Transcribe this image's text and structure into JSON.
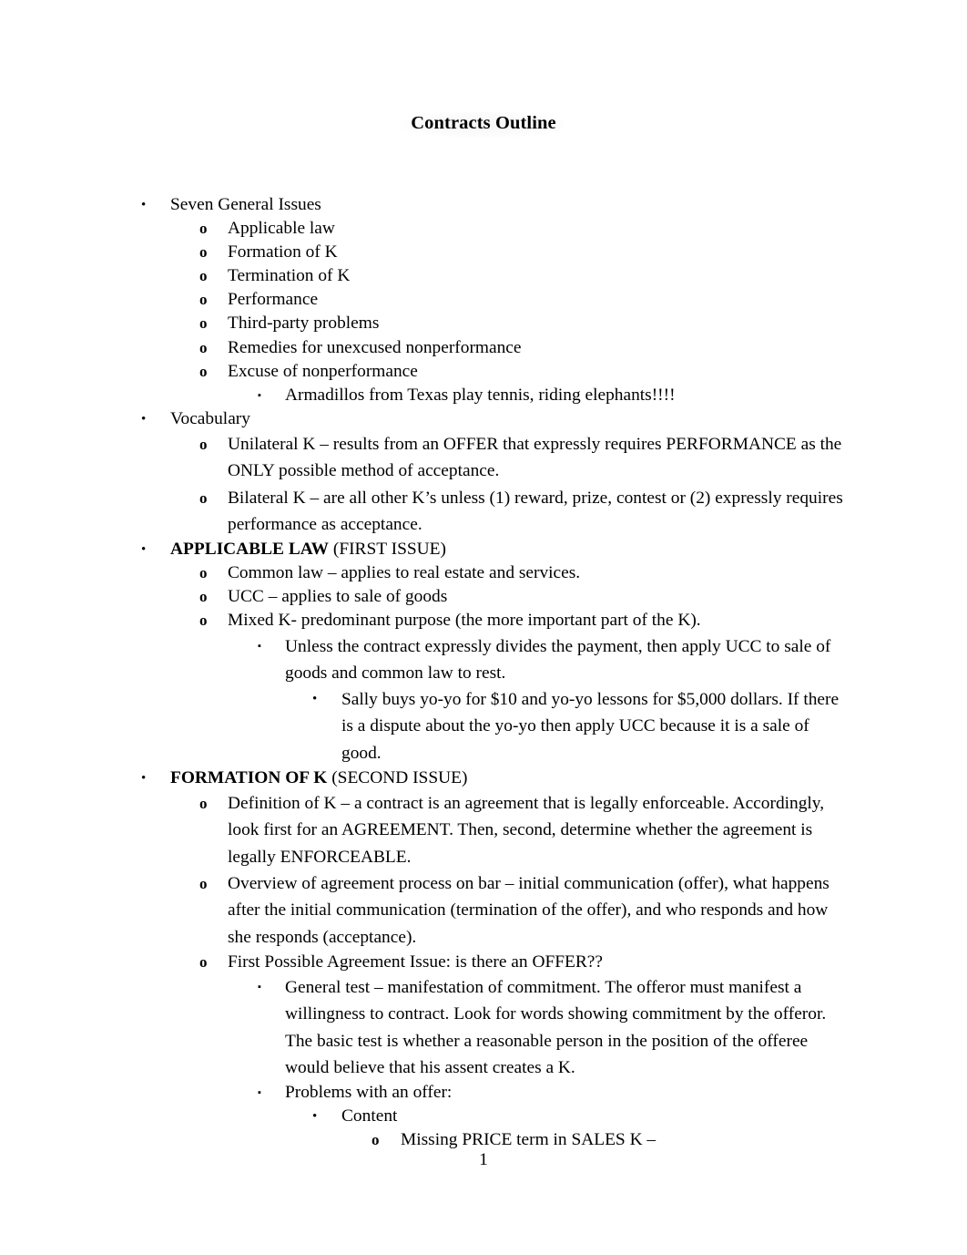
{
  "document": {
    "title": "Contracts Outline",
    "page_number": "1"
  },
  "markers": {
    "bullet_round": "•",
    "bullet_circle_o": "o",
    "bullet_square": "▪"
  },
  "outline": [
    {
      "level": 1,
      "marker": "•",
      "text": "Seven General Issues",
      "multiline": false
    },
    {
      "level": 2,
      "marker": "o",
      "text": "Applicable law",
      "multiline": false
    },
    {
      "level": 2,
      "marker": "o",
      "text": "Formation of K",
      "multiline": false
    },
    {
      "level": 2,
      "marker": "o",
      "text": "Termination of K",
      "multiline": false
    },
    {
      "level": 2,
      "marker": "o",
      "text": "Performance",
      "multiline": false
    },
    {
      "level": 2,
      "marker": "o",
      "text": "Third-party problems",
      "multiline": false
    },
    {
      "level": 2,
      "marker": "o",
      "text": "Remedies for unexcused nonperformance",
      "multiline": false
    },
    {
      "level": 2,
      "marker": "o",
      "text": "Excuse of nonperformance",
      "multiline": false
    },
    {
      "level": 3,
      "marker": "▪",
      "text": "Armadillos from Texas play tennis, riding elephants!!!!",
      "multiline": false
    },
    {
      "level": 1,
      "marker": "•",
      "text": "Vocabulary",
      "multiline": false
    },
    {
      "level": 2,
      "marker": "o",
      "text": "Unilateral K – results from an OFFER that expressly requires PERFORMANCE as the ONLY possible method of acceptance.",
      "multiline": true
    },
    {
      "level": 2,
      "marker": "o",
      "text": "Bilateral K – are all other K’s unless (1) reward, prize, contest or (2) expressly requires performance as acceptance.",
      "multiline": true
    },
    {
      "level": 1,
      "marker": "•",
      "bold_prefix": "APPLICABLE LAW",
      "text": " (FIRST ISSUE)",
      "multiline": false
    },
    {
      "level": 2,
      "marker": "o",
      "text": "Common law – applies to real estate and services.",
      "multiline": false
    },
    {
      "level": 2,
      "marker": "o",
      "text": "UCC – applies to sale of goods",
      "multiline": false
    },
    {
      "level": 2,
      "marker": "o",
      "text": "Mixed K- predominant purpose (the more important part of the K).",
      "multiline": false
    },
    {
      "level": 3,
      "marker": "▪",
      "text": "Unless the contract expressly divides the payment, then apply UCC to sale of goods and common law to rest.",
      "multiline": true
    },
    {
      "level": 4,
      "marker": "•",
      "text": "Sally buys yo-yo for $10 and yo-yo lessons for $5,000 dollars. If there is a dispute about the yo-yo then apply UCC because it is a sale of good.",
      "multiline": true
    },
    {
      "level": 1,
      "marker": "•",
      "bold_prefix": "FORMATION OF K",
      "text": " (SECOND ISSUE)",
      "multiline": false
    },
    {
      "level": 2,
      "marker": "o",
      "text": "Definition of K – a contract is an agreement that is legally enforceable. Accordingly, look first for an AGREEMENT. Then, second, determine whether the agreement is legally ENFORCEABLE.",
      "multiline": true
    },
    {
      "level": 2,
      "marker": "o",
      "text": "Overview of agreement process on bar – initial communication (offer), what happens after the initial communication (termination of the offer), and who responds and how she responds (acceptance).",
      "multiline": true
    },
    {
      "level": 2,
      "marker": "o",
      "text": "First Possible Agreement Issue: is there an OFFER??",
      "multiline": false
    },
    {
      "level": 3,
      "marker": "▪",
      "text": "General test – manifestation of commitment. The offeror must manifest a willingness to contract. Look for words showing commitment by the offeror. The basic test is whether a reasonable person in the position of the offeree would believe that his assent creates a K.",
      "multiline": true
    },
    {
      "level": 3,
      "marker": "▪",
      "text": "Problems with an offer:",
      "multiline": false
    },
    {
      "level": 4,
      "marker": "•",
      "text": "Content",
      "multiline": false
    },
    {
      "level": 5,
      "marker": "o",
      "text": "Missing PRICE term in SALES K –",
      "multiline": false
    }
  ]
}
